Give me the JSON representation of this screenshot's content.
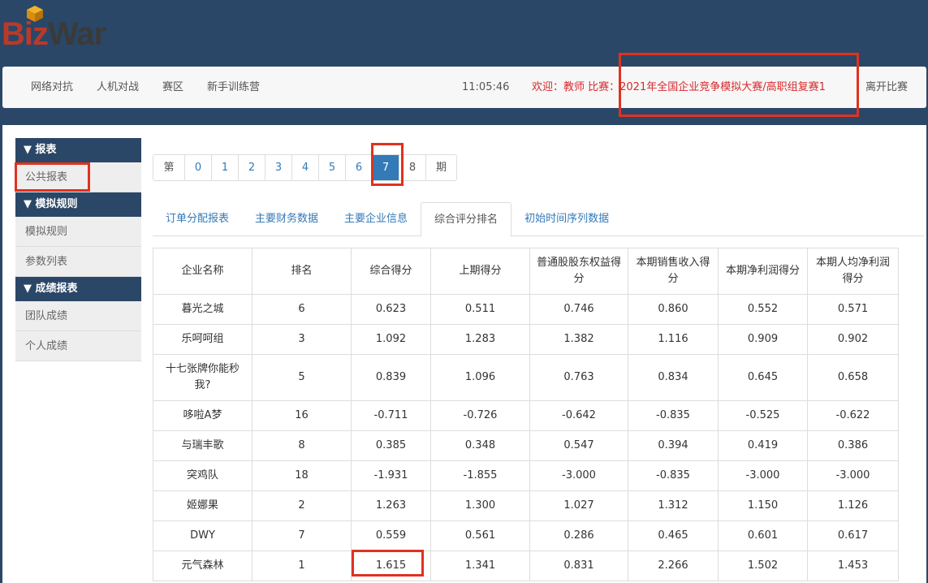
{
  "logo": {
    "biz": "Biz",
    "war": "War"
  },
  "topnav": {
    "items": [
      "网络对抗",
      "人机对战",
      "赛区",
      "新手训练营"
    ],
    "clock": "11:05:46",
    "welcome": "欢迎：教师 比赛：2021年全国企业竞争模拟大赛/高职组复赛1",
    "leave": "离开比赛"
  },
  "sidebar": {
    "sections": [
      {
        "title": "▼ 报表",
        "items": [
          "公共报表"
        ]
      },
      {
        "title": "▼ 模拟规则",
        "items": [
          "模拟规则",
          "参数列表"
        ]
      },
      {
        "title": "▼ 成绩报表",
        "items": [
          "团队成绩",
          "个人成绩"
        ]
      }
    ]
  },
  "pager": {
    "prefix": "第",
    "pages": [
      "0",
      "1",
      "2",
      "3",
      "4",
      "5",
      "6",
      "7",
      "8"
    ],
    "suffix": "期",
    "active": "7"
  },
  "tabs": [
    "订单分配报表",
    "主要财务数据",
    "主要企业信息",
    "综合评分排名",
    "初始时间序列数据"
  ],
  "active_tab": "综合评分排名",
  "table": {
    "headers": [
      "企业名称",
      "排名",
      "综合得分",
      "上期得分",
      "普通股股东权益得分",
      "本期销售收入得分",
      "本期净利润得分",
      "本期人均净利润得分"
    ],
    "rows": [
      [
        "暮光之城",
        "6",
        "0.623",
        "0.511",
        "0.746",
        "0.860",
        "0.552",
        "0.571"
      ],
      [
        "乐呵呵组",
        "3",
        "1.092",
        "1.283",
        "1.382",
        "1.116",
        "0.909",
        "0.902"
      ],
      [
        "十七张牌你能秒我?",
        "5",
        "0.839",
        "1.096",
        "0.763",
        "0.834",
        "0.645",
        "0.658"
      ],
      [
        "哆啦A梦",
        "16",
        "-0.711",
        "-0.726",
        "-0.642",
        "-0.835",
        "-0.525",
        "-0.622"
      ],
      [
        "与瑞丰歌",
        "8",
        "0.385",
        "0.348",
        "0.547",
        "0.394",
        "0.419",
        "0.386"
      ],
      [
        "突鸡队",
        "18",
        "-1.931",
        "-1.855",
        "-3.000",
        "-0.835",
        "-3.000",
        "-3.000"
      ],
      [
        "姬娜果",
        "2",
        "1.263",
        "1.300",
        "1.027",
        "1.312",
        "1.150",
        "1.126"
      ],
      [
        "DWY",
        "7",
        "0.559",
        "0.561",
        "0.286",
        "0.465",
        "0.601",
        "0.617"
      ],
      [
        "元气森林",
        "1",
        "1.615",
        "1.341",
        "0.831",
        "2.266",
        "1.502",
        "1.453"
      ]
    ]
  },
  "colors": {
    "header_bg": "#2b4767",
    "accent": "#337ab7",
    "annotation": "#e0321f",
    "welcome": "#d9292c"
  }
}
